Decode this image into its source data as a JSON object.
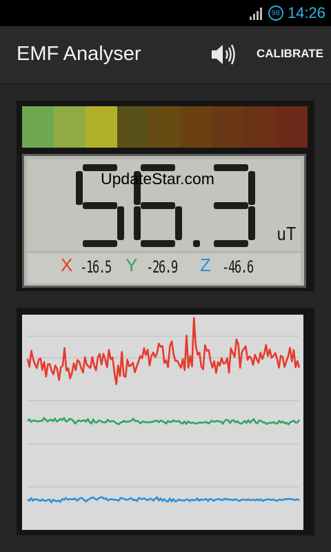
{
  "status_bar": {
    "time": "14:26",
    "battery": "98"
  },
  "action_bar": {
    "title": "EMF Analyser",
    "calibrate_label": "CALIBRATE"
  },
  "meter": {
    "value": "56.3",
    "unit": "uT",
    "scale_colors": [
      "#6ea851",
      "#90ab43",
      "#b0b129",
      "#5a5119",
      "#674b12",
      "#6b4111",
      "#6a3814",
      "#6a3116",
      "#6b2a1a"
    ],
    "axes": [
      {
        "name": "X",
        "value": "-16.5",
        "color": "#e53b2c"
      },
      {
        "name": "Y",
        "value": "-26.9",
        "color": "#2ca565"
      },
      {
        "name": "Z",
        "value": "-46.6",
        "color": "#2e8fd9"
      }
    ]
  },
  "watermark": "UpdateStar.com",
  "graph": {
    "series": [
      {
        "color": "#e53b2c",
        "values": [
          19.5,
          15.8,
          23.2,
          19.5,
          16.8,
          15.2,
          19.1,
          19.6,
          14.3,
          18.0,
          11.2,
          17.0,
          17.0,
          14.0,
          12.3,
          16.4,
          14.8,
          9.6,
          15.5,
          16.3,
          24.5,
          14.0,
          15.1,
          10.4,
          12.9,
          17.4,
          14.2,
          18.9,
          18.1,
          15.2,
          13.1,
          20.2,
          16.7,
          16.0,
          15.2,
          20.3,
          16.5,
          14.1,
          20.1,
          21.8,
          16.8,
          21.8,
          19.2,
          15.6,
          23.6,
          19.3,
          20.1,
          12.8,
          7.7,
          16.4,
          11.5,
          22.7,
          11.5,
          11.1,
          19.1,
          16.0,
          16.5,
          17.6,
          13.2,
          15.7,
          18.1,
          20.8,
          19.7,
          24.4,
          21.2,
          23.7,
          16.4,
          20.8,
          22.4,
          20.3,
          21.9,
          26.5,
          25.1,
          25.4,
          17.5,
          18.9,
          15.6,
          25.4,
          27.6,
          21.6,
          18.5,
          18.6,
          16.9,
          15.3,
          19.4,
          14.2,
          30.3,
          15.3,
          20.8,
          15.9,
          38.5,
          25.6,
          21.3,
          22.4,
          15.9,
          14.6,
          25.8,
          23.2,
          23.6,
          18.6,
          15.4,
          18.4,
          12.9,
          18.0,
          16.3,
          19.8,
          17.2,
          17.6,
          19.8,
          13.0,
          24.4,
          22.2,
          20.4,
          28.5,
          26.2,
          15.3,
          22.7,
          24.1,
          25.3,
          19.0,
          20.6,
          19.8,
          16.7,
          21.3,
          19.3,
          17.6,
          22.3,
          19.4,
          21.8,
          25.9,
          20.8,
          23.8,
          20.0,
          20.8,
          22.2,
          19.5,
          15.4,
          20.9,
          20.4,
          15.7,
          18.3,
          20.7,
          24.6,
          18.3,
          23.6,
          15.5,
          18.5,
          15.4
        ]
      },
      {
        "color": "#2ca565",
        "values": [
          -9.4,
          -8.6,
          -9.8,
          -9.2,
          -9.3,
          -9.5,
          -9.6,
          -9.3,
          -9.4,
          -8.0,
          -8.8,
          -9.6,
          -9.0,
          -8.8,
          -9.5,
          -8.3,
          -9.6,
          -9.2,
          -8.4,
          -9.0,
          -8.0,
          -9.6,
          -9.4,
          -8.4,
          -8.6,
          -9.3,
          -10.6,
          -9.8,
          -9.1,
          -9.5,
          -9.4,
          -9.0,
          -9.7,
          -8.5,
          -9.9,
          -10.6,
          -8.7,
          -10.0,
          -10.1,
          -9.2,
          -9.3,
          -9.9,
          -10.1,
          -9.9,
          -8.8,
          -9.6,
          -9.6,
          -9.4,
          -10.0,
          -10.6,
          -10.9,
          -10.1,
          -9.9,
          -9.3,
          -9.9,
          -9.6,
          -9.6,
          -9.1,
          -8.3,
          -9.5,
          -9.3,
          -9.8,
          -10.5,
          -9.6,
          -9.7,
          -10.1,
          -10.0,
          -10.0,
          -9.9,
          -9.6,
          -9.3,
          -9.3,
          -10.0,
          -9.2,
          -9.5,
          -10.0,
          -10.6,
          -9.4,
          -9.8,
          -9.8,
          -9.0,
          -9.6,
          -9.6,
          -9.4,
          -10.2,
          -10.6,
          -9.6,
          -10.8,
          -9.6,
          -10.2,
          -10.3,
          -10.2,
          -10.6,
          -10.5,
          -10.1,
          -10.2,
          -10.1,
          -10.1,
          -9.8,
          -10.6,
          -10.1,
          -9.3,
          -9.6,
          -9.7,
          -9.3,
          -9.6,
          -9.7,
          -10.7,
          -9.5,
          -8.8,
          -9.1,
          -10.4,
          -9.2,
          -9.0,
          -10.0,
          -9.5,
          -10.3,
          -10.7,
          -10.2,
          -9.4,
          -10.3,
          -9.0,
          -10.2,
          -9.3,
          -8.5,
          -10.0,
          -10.5,
          -9.2,
          -9.2,
          -10.1,
          -10.1,
          -10.8,
          -10.4,
          -10.2,
          -10.3,
          -9.9,
          -10.5,
          -10.6,
          -9.3,
          -10.2,
          -9.6,
          -10.5,
          -10.2,
          -11.0,
          -10.0,
          -9.7,
          -9.2,
          -10.2,
          -10.1,
          -8.8
        ]
      },
      {
        "color": "#2e8fd9",
        "values": [
          -45.9,
          -46.4,
          -45.2,
          -46.5,
          -45.7,
          -45.8,
          -46.2,
          -46.5,
          -45.8,
          -46.4,
          -46.5,
          -46.1,
          -45.9,
          -47.2,
          -46.0,
          -46.4,
          -46.7,
          -46.3,
          -47.0,
          -45.6,
          -46.0,
          -45.2,
          -46.0,
          -45.7,
          -45.7,
          -45.8,
          -45.4,
          -46.4,
          -45.9,
          -45.1,
          -45.3,
          -46.1,
          -46.8,
          -46.1,
          -45.6,
          -45.1,
          -44.9,
          -45.6,
          -46.0,
          -45.3,
          -44.9,
          -44.8,
          -45.6,
          -45.3,
          -46.3,
          -45.9,
          -45.7,
          -45.9,
          -46.0,
          -46.1,
          -46.4,
          -45.2,
          -45.3,
          -45.6,
          -46.0,
          -46.0,
          -45.5,
          -45.2,
          -46.2,
          -46.0,
          -46.6,
          -45.1,
          -45.6,
          -45.6,
          -45.3,
          -45.9,
          -46.2,
          -45.6,
          -45.6,
          -46.4,
          -45.5,
          -44.8,
          -46.3,
          -45.4,
          -46.5,
          -45.7,
          -46.5,
          -46.9,
          -45.4,
          -46.8,
          -45.6,
          -46.8,
          -46.5,
          -45.8,
          -46.3,
          -46.2,
          -46.4,
          -45.9,
          -45.9,
          -46.6,
          -45.9,
          -46.3,
          -46.1,
          -45.4,
          -46.4,
          -45.8,
          -46.1,
          -45.9,
          -45.6,
          -46.6,
          -45.6,
          -45.8,
          -46.5,
          -46.0,
          -45.7,
          -45.6,
          -46.1,
          -46.2,
          -45.4,
          -45.9,
          -45.7,
          -46.1,
          -45.9,
          -46.2,
          -45.7,
          -46.1,
          -46.6,
          -46.1,
          -45.9,
          -45.9,
          -46.2,
          -45.8,
          -46.2,
          -46.1,
          -45.9,
          -46.3,
          -45.7,
          -46.3,
          -45.8,
          -46.6,
          -46.1,
          -45.9,
          -45.8,
          -45.9,
          -46.1,
          -45.8,
          -46.4,
          -46.4,
          -45.9,
          -46.1,
          -46.1,
          -45.6,
          -45.8,
          -45.7,
          -45.6,
          -45.7,
          -46.1,
          -46.0,
          -45.7,
          -46.3
        ]
      }
    ]
  }
}
